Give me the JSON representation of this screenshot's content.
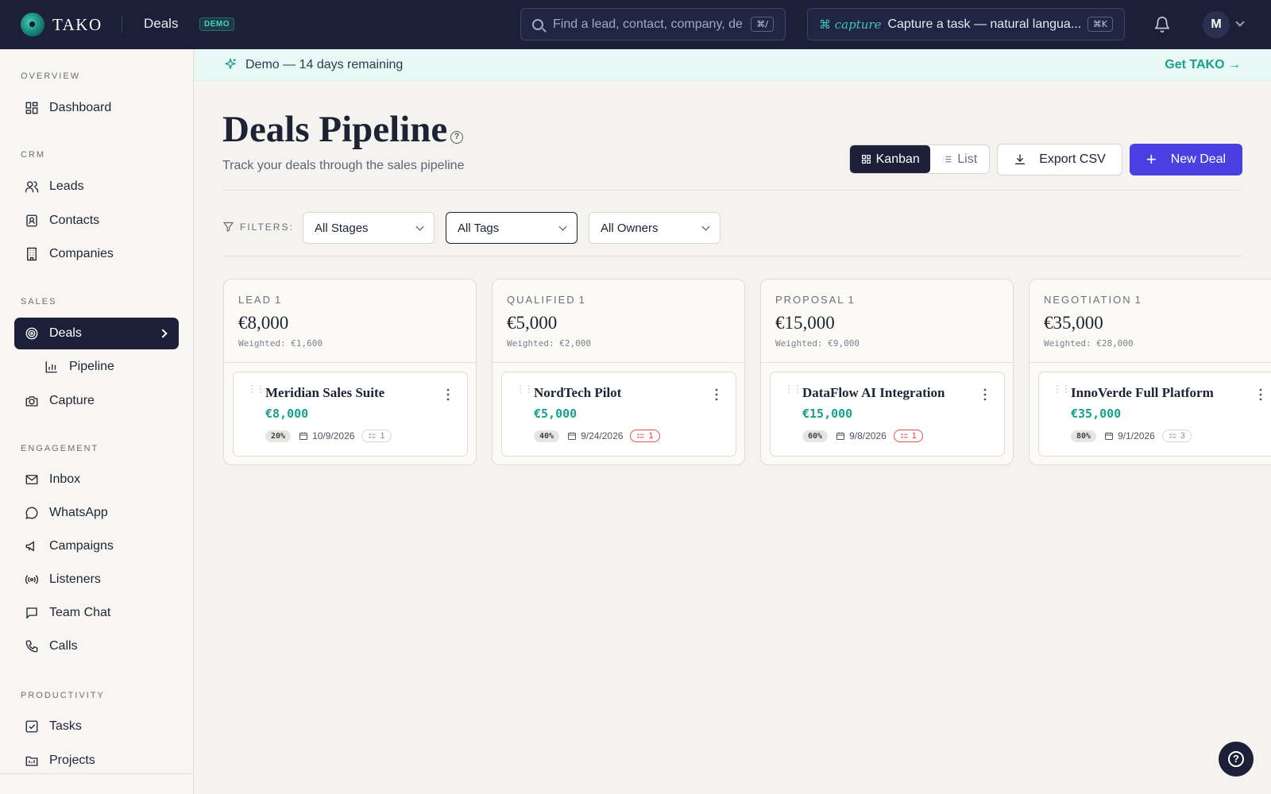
{
  "app": {
    "name": "TAKO",
    "section": "Deals",
    "badge": "DEMO"
  },
  "search": {
    "placeholder": "Find a lead, contact, company, de",
    "shortcut": "⌘/"
  },
  "capture": {
    "brand": "⌘ capture",
    "text": "Capture a task — natural langua...",
    "shortcut": "⌘K"
  },
  "user": {
    "initial": "M"
  },
  "sidebar": {
    "sections": {
      "overview": "OVERVIEW",
      "crm": "CRM",
      "sales": "SALES",
      "engagement": "ENGAGEMENT",
      "productivity": "PRODUCTIVITY"
    },
    "items": {
      "dashboard": "Dashboard",
      "leads": "Leads",
      "contacts": "Contacts",
      "companies": "Companies",
      "deals": "Deals",
      "pipeline": "Pipeline",
      "capture": "Capture",
      "inbox": "Inbox",
      "whatsapp": "WhatsApp",
      "campaigns": "Campaigns",
      "listeners": "Listeners",
      "team_chat": "Team Chat",
      "calls": "Calls",
      "tasks": "Tasks",
      "projects": "Projects"
    }
  },
  "banner": {
    "text": "Demo — 14 days remaining",
    "link": "Get TAKO →"
  },
  "header": {
    "title": "Deals Pipeline",
    "subtitle": "Track your deals through the sales pipeline",
    "view_kanban": "Kanban",
    "view_list": "List",
    "export": "Export CSV",
    "new_deal": "New Deal"
  },
  "filters": {
    "label": "FILTERS:",
    "stages": "All Stages",
    "tags": "All Tags",
    "owners": "All Owners"
  },
  "columns": [
    {
      "stage": "LEAD",
      "count": "1",
      "amount": "€8,000",
      "weighted": "Weighted: €1,600",
      "card": {
        "title": "Meridian Sales Suite",
        "amount": "€8,000",
        "probability": "20%",
        "date": "10/9/2026",
        "tasks": "1",
        "overdue": false
      }
    },
    {
      "stage": "QUALIFIED",
      "count": "1",
      "amount": "€5,000",
      "weighted": "Weighted: €2,000",
      "card": {
        "title": "NordTech Pilot",
        "amount": "€5,000",
        "probability": "40%",
        "date": "9/24/2026",
        "tasks": "1",
        "overdue": true
      }
    },
    {
      "stage": "PROPOSAL",
      "count": "1",
      "amount": "€15,000",
      "weighted": "Weighted: €9,000",
      "card": {
        "title": "DataFlow AI Integration",
        "amount": "€15,000",
        "probability": "60%",
        "date": "9/8/2026",
        "tasks": "1",
        "overdue": true
      }
    },
    {
      "stage": "NEGOTIATION",
      "count": "1",
      "amount": "€35,000",
      "weighted": "Weighted: €28,000",
      "card": {
        "title": "InnoVerde Full Platform",
        "amount": "€35,000",
        "probability": "80%",
        "date": "9/1/2026",
        "tasks": "3",
        "overdue": false
      }
    }
  ],
  "colors": {
    "accent": "#4a3fe0",
    "navy": "#1b2038",
    "teal": "#17a08b",
    "overdue": "#d5463c"
  }
}
